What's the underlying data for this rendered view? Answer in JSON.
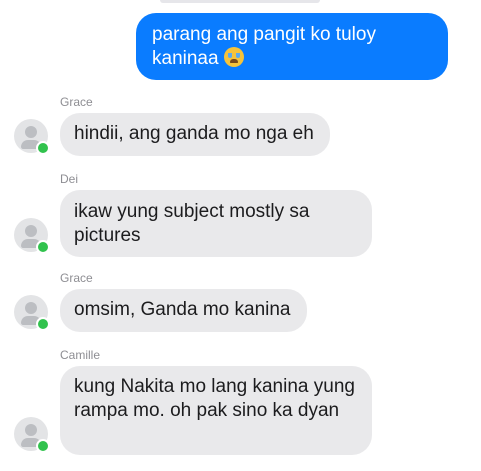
{
  "outgoing": [
    {
      "text": "parang ang pangit ko tuloy",
      "text2": "kaninaa",
      "emoji": "loudly-crying-face-emoji"
    }
  ],
  "messages": [
    {
      "sender": "Grace",
      "text": "hindii, ang ganda mo nga eh"
    },
    {
      "sender": "Dei",
      "text": "ikaw yung subject mostly sa pictures"
    },
    {
      "sender": "Grace",
      "text": "omsim, Ganda mo kanina"
    },
    {
      "sender": "Camille",
      "text": "kung Nakita mo lang kanina yung rampa mo. oh pak sino ka dyan"
    }
  ],
  "colors": {
    "outgoing_bubble": "#0a7cff",
    "incoming_bubble": "#e9e9eb",
    "online_dot": "#31c24d"
  }
}
